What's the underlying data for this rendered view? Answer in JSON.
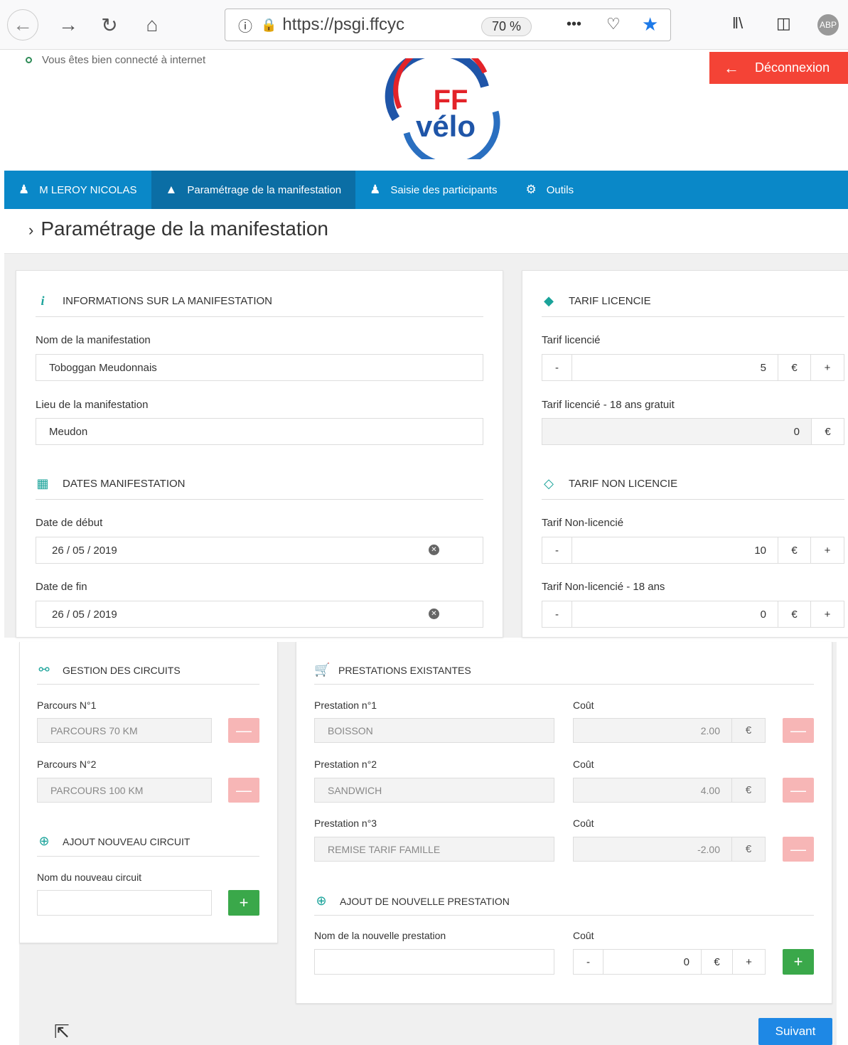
{
  "browser": {
    "url": "https://psgi.ffcyc",
    "zoom": "70 %",
    "more": "•••",
    "library_icon": "library-icon",
    "adblock": "ABP"
  },
  "header": {
    "status": "Vous êtes bien connecté à internet",
    "logout": "Déconnexion",
    "logo_top": "FF",
    "logo_bottom": "vélo"
  },
  "nav": {
    "user": "M LEROY NICOLAS",
    "param": "Paramétrage de la manifestation",
    "saisie": "Saisie des participants",
    "outils": "Outils"
  },
  "page_title": "Paramétrage de la manifestation",
  "info": {
    "title": "INFORMATIONS SUR LA MANIFESTATION",
    "nom_label": "Nom de la manifestation",
    "nom_value": "Toboggan Meudonnais",
    "lieu_label": "Lieu de la manifestation",
    "lieu_value": "Meudon"
  },
  "dates": {
    "title": "DATES MANIFESTATION",
    "debut_label": "Date de début",
    "debut_value": "26 / 05 / 2019",
    "fin_label": "Date de fin",
    "fin_value": "26 / 05 / 2019"
  },
  "licencie": {
    "title": "TARIF LICENCIE",
    "tarif_label": "Tarif licencié",
    "tarif_value": "5",
    "moins18_label": "Tarif licencié - 18 ans gratuit",
    "moins18_value": "0"
  },
  "non_licencie": {
    "title": "TARIF NON LICENCIE",
    "tarif_label": "Tarif Non-licencié",
    "tarif_value": "10",
    "moins18_label": "Tarif Non-licencié - 18 ans",
    "moins18_value": "0"
  },
  "common": {
    "minus": "-",
    "plus": "+",
    "euro": "€",
    "remove": "—",
    "add": "+"
  },
  "circuits": {
    "title": "GESTION DES CIRCUITS",
    "items": [
      {
        "label": "Parcours N°1",
        "value": "PARCOURS 70 KM"
      },
      {
        "label": "Parcours N°2",
        "value": "PARCOURS 100 KM"
      }
    ],
    "add_title": "AJOUT NOUVEAU CIRCUIT",
    "new_label": "Nom du nouveau circuit"
  },
  "prestations": {
    "title": "PRESTATIONS EXISTANTES",
    "cost_label": "Coût",
    "items": [
      {
        "label": "Prestation n°1",
        "value": "BOISSON",
        "cost": "2.00"
      },
      {
        "label": "Prestation n°2",
        "value": "SANDWICH",
        "cost": "4.00"
      },
      {
        "label": "Prestation n°3",
        "value": "REMISE TARIF FAMILLE",
        "cost": "-2.00"
      }
    ],
    "add_title": "AJOUT DE NOUVELLE PRESTATION",
    "new_label": "Nom de la nouvelle prestation",
    "new_cost": "0"
  },
  "next": "Suivant",
  "colors": {
    "accent": "#0a88c8",
    "danger": "#f44336",
    "success": "#3aa84a",
    "teal": "#1aa39a"
  }
}
